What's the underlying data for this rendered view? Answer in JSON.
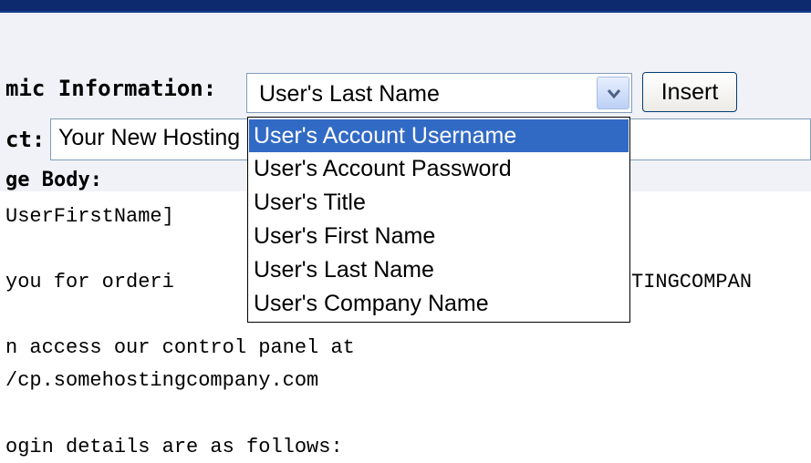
{
  "form": {
    "dynamic_label": "mic Information:",
    "subject_label": "ct:",
    "body_label": "ge Body:",
    "subject_value": "Your New Hosting"
  },
  "select": {
    "value": "User's Last Name",
    "arrow_icon": "chevron-down-icon"
  },
  "insert_label": "Insert",
  "dropdown": {
    "options": [
      "User's Account Username",
      "User's Account Password",
      "User's Title",
      "User's First Name",
      "User's Last Name",
      "User's Company Name"
    ],
    "highlighted": "User's Account Username"
  },
  "body_text": {
    "line1": "UserFirstName]",
    "line2": "you for orderi",
    "line2_tail": "TINGCOMPAN",
    "line3": "n access our control panel at",
    "line4": "/cp.somehostingcompany.com",
    "line5": "ogin details are as follows:"
  },
  "colors": {
    "title_bar": "#0e2a6e",
    "selection": "#316ac5",
    "panel": "#f1f2f8"
  }
}
